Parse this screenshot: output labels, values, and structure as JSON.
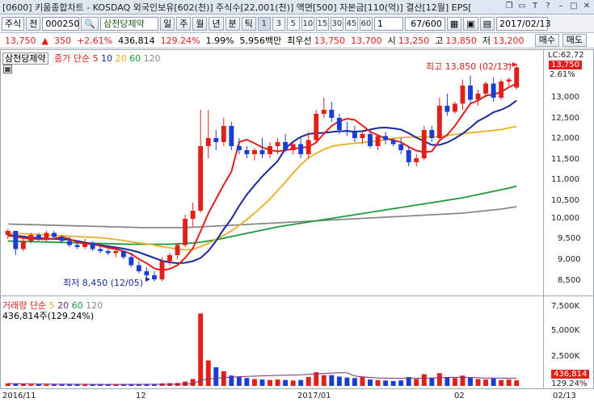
{
  "titlebar": {
    "text": "[0600] 키움종합차트 - KOSDAQ 외국인보유[602(천)] 주식수[22,001(천)] 액면[500] 자본금[110(억)] 결산[12월] EPS["
  },
  "toolbar": {
    "market": "주식",
    "prev": "전",
    "code": "000250",
    "name": "삼천당제약",
    "periods": [
      "일",
      "주",
      "월",
      "년",
      "분",
      "틱"
    ],
    "numbers": [
      "1",
      "3",
      "5",
      "10",
      "15",
      "30",
      "45",
      "60"
    ],
    "count": "67/600",
    "date": "2017/02/13"
  },
  "pricebar": {
    "price": "13,750",
    "arrow": "▲",
    "change": "350",
    "change_pct": "+2.61%",
    "volume": "436,814",
    "vol_ratio": "129.24%",
    "turnover": "1.99%",
    "amount": "5,956백만",
    "pref_label": "최우선",
    "pref": "13,750",
    "ask": "13,700",
    "open_label": "시",
    "open": "13,250",
    "high_label": "고",
    "high": "13,850",
    "low_label": "저",
    "low": "13,200",
    "buy": "매수",
    "sell": "매도"
  },
  "price_panel": {
    "title": "삼천당제약",
    "legend_main": "종가 단순",
    "ma": [
      "5",
      "10",
      "20",
      "60",
      "120"
    ],
    "ma_colors": [
      "#e0201b",
      "#1a2a9a",
      "#e8b020",
      "#1f9a3a",
      "#888888"
    ],
    "lc": "LC:62.72",
    "last_price": "13,750",
    "last_pct": "2.61%",
    "max_note": "최고 13,850 (02/13)",
    "min_note": "최저 8,450 (12/05)",
    "y_ticks": [
      "13,000",
      "12,500",
      "12,000",
      "11,500",
      "11,000",
      "10,500",
      "10,000",
      "9,500",
      "9,000",
      "8,500"
    ]
  },
  "volume_panel": {
    "legend_main": "거래량 단순",
    "ma": [
      "5",
      "20",
      "60",
      "120"
    ],
    "current": "436,814주(129.24%)",
    "last_value": "436,814",
    "last_pct": "129.24%",
    "y_ticks": [
      "7,500K",
      "5,000K",
      "2,500K"
    ]
  },
  "x_labels": [
    "2016/11",
    "12",
    "2017/01",
    "02",
    "02/13"
  ],
  "chart_data": {
    "type": "candlestick",
    "ylim": [
      8200,
      14100
    ],
    "candles": [
      [
        9600,
        9750,
        9500,
        9700
      ],
      [
        9700,
        9700,
        9100,
        9250
      ],
      [
        9250,
        9500,
        9200,
        9450
      ],
      [
        9450,
        9650,
        9400,
        9600
      ],
      [
        9600,
        9650,
        9450,
        9500
      ],
      [
        9500,
        9700,
        9450,
        9650
      ],
      [
        9650,
        9700,
        9500,
        9550
      ],
      [
        9550,
        9600,
        9400,
        9450
      ],
      [
        9450,
        9550,
        9300,
        9350
      ],
      [
        9350,
        9450,
        9250,
        9300
      ],
      [
        9300,
        9500,
        9250,
        9400
      ],
      [
        9400,
        9450,
        9200,
        9250
      ],
      [
        9250,
        9350,
        9150,
        9200
      ],
      [
        9200,
        9250,
        9100,
        9150
      ],
      [
        9150,
        9250,
        9050,
        9200
      ],
      [
        9200,
        9200,
        9000,
        9050
      ],
      [
        9050,
        9150,
        8800,
        8850
      ],
      [
        8850,
        8950,
        8650,
        8700
      ],
      [
        8700,
        8800,
        8550,
        8600
      ],
      [
        8600,
        8700,
        8450,
        8500
      ],
      [
        8500,
        9050,
        8450,
        8950
      ],
      [
        8950,
        9150,
        8850,
        9100
      ],
      [
        9100,
        9400,
        9000,
        9350
      ],
      [
        9350,
        10100,
        9300,
        10000
      ],
      [
        10000,
        10400,
        9800,
        10200
      ],
      [
        10200,
        12700,
        10150,
        11800
      ],
      [
        11800,
        12700,
        11500,
        12000
      ],
      [
        12000,
        12200,
        11700,
        11900
      ],
      [
        11900,
        12500,
        11800,
        12300
      ],
      [
        12300,
        12400,
        11700,
        11800
      ],
      [
        11800,
        12000,
        11600,
        11700
      ],
      [
        11700,
        11800,
        11500,
        11600
      ],
      [
        11600,
        11750,
        11450,
        11700
      ],
      [
        11700,
        12000,
        11500,
        11600
      ],
      [
        11600,
        11900,
        11500,
        11800
      ],
      [
        11800,
        12000,
        11600,
        11900
      ],
      [
        11900,
        12100,
        11650,
        11700
      ],
      [
        11700,
        11900,
        11600,
        11850
      ],
      [
        11850,
        12000,
        11500,
        11600
      ],
      [
        11600,
        12150,
        11500,
        11950
      ],
      [
        11950,
        12700,
        11900,
        12600
      ],
      [
        12600,
        13000,
        12500,
        12700
      ],
      [
        12700,
        12900,
        12400,
        12500
      ],
      [
        12500,
        12600,
        12100,
        12200
      ],
      [
        12200,
        12400,
        12050,
        12150
      ],
      [
        12150,
        12300,
        11900,
        12000
      ],
      [
        12000,
        12200,
        11850,
        12100
      ],
      [
        12100,
        12150,
        11750,
        11800
      ],
      [
        11800,
        12100,
        11700,
        12050
      ],
      [
        12050,
        12150,
        11850,
        11950
      ],
      [
        11950,
        12000,
        11800,
        11850
      ],
      [
        11850,
        12000,
        11600,
        11700
      ],
      [
        11700,
        11800,
        11300,
        11400
      ],
      [
        11400,
        11600,
        11300,
        11500
      ],
      [
        11500,
        12300,
        11450,
        12200
      ],
      [
        12200,
        12300,
        11900,
        12000
      ],
      [
        12000,
        13000,
        11950,
        12800
      ],
      [
        12800,
        13100,
        12550,
        12650
      ],
      [
        12650,
        12900,
        12600,
        12850
      ],
      [
        12850,
        13450,
        12700,
        13300
      ],
      [
        13300,
        13550,
        12850,
        12950
      ],
      [
        12950,
        13200,
        12800,
        13100
      ],
      [
        13100,
        13400,
        13000,
        13350
      ],
      [
        13350,
        13500,
        12900,
        13000
      ],
      [
        13000,
        13450,
        12950,
        13400
      ],
      [
        13400,
        13500,
        13300,
        13450
      ],
      [
        13250,
        13850,
        13200,
        13750
      ]
    ],
    "volumes_k": [
      250,
      200,
      180,
      150,
      170,
      140,
      130,
      160,
      150,
      140,
      130,
      120,
      150,
      140,
      130,
      160,
      190,
      200,
      170,
      160,
      260,
      280,
      300,
      450,
      700,
      7400,
      2600,
      1900,
      1500,
      1050,
      900,
      800,
      700,
      650,
      600,
      650,
      600,
      550,
      600,
      900,
      1400,
      1100,
      1100,
      950,
      850,
      800,
      900,
      650,
      600,
      550,
      500,
      560,
      900,
      700,
      1200,
      800,
      1300,
      900,
      800,
      1050,
      850,
      700,
      650,
      750,
      600,
      650,
      560
    ],
    "ma_values": {
      "5": [
        9580,
        9560,
        9520,
        9500,
        9500,
        9490,
        9510,
        9550,
        9500,
        9420,
        9380,
        9370,
        9330,
        9280,
        9250,
        9200,
        9130,
        9000,
        8900,
        8770,
        8720,
        8760,
        8850,
        9030,
        9270,
        9690,
        10130,
        10490,
        10840,
        11170,
        11900,
        11960,
        11870,
        11770,
        11700,
        11670,
        11700,
        11730,
        11760,
        11780,
        11890,
        12110,
        12300,
        12420,
        12480,
        12450,
        12310,
        12160,
        12070,
        11990,
        11950,
        11900,
        11780,
        11690,
        11650,
        11670,
        11940,
        12080,
        12300,
        12580,
        12850,
        12930,
        13050,
        13080,
        13140,
        13260,
        13350
      ],
      "10": [
        9600,
        9580,
        9560,
        9540,
        9520,
        9510,
        9500,
        9500,
        9480,
        9450,
        9410,
        9380,
        9350,
        9320,
        9290,
        9260,
        9220,
        9170,
        9100,
        9030,
        8960,
        8920,
        8900,
        8910,
        8950,
        9030,
        9200,
        9450,
        9740,
        10000,
        10320,
        10600,
        10830,
        11050,
        11240,
        11430,
        11740,
        11910,
        12030,
        12100,
        12120,
        12130,
        12150,
        12170,
        12170,
        12160,
        12170,
        12210,
        12250,
        12260,
        12240,
        12210,
        12120,
        12010,
        11920,
        11830,
        11830,
        11890,
        11990,
        12110,
        12260,
        12420,
        12520,
        12640,
        12700,
        12790,
        12930
      ],
      "20": [
        9650,
        9640,
        9630,
        9620,
        9610,
        9600,
        9590,
        9580,
        9570,
        9560,
        9550,
        9540,
        9530,
        9510,
        9490,
        9460,
        9430,
        9400,
        9380,
        9350,
        9310,
        9280,
        9250,
        9230,
        9240,
        9310,
        9390,
        9490,
        9590,
        9700,
        9830,
        9980,
        10140,
        10310,
        10490,
        10700,
        10910,
        11130,
        11340,
        11510,
        11620,
        11720,
        11790,
        11830,
        11850,
        11870,
        11890,
        11910,
        11930,
        11960,
        11990,
        12010,
        12020,
        12030,
        12030,
        12030,
        12040,
        12060,
        12090,
        12110,
        12130,
        12150,
        12170,
        12190,
        12210,
        12250,
        12290
      ],
      "60": [
        9450,
        9445,
        9440,
        9435,
        9430,
        9425,
        9420,
        9415,
        9410,
        9405,
        9400,
        9395,
        9390,
        9385,
        9380,
        9375,
        9370,
        9370,
        9370,
        9370,
        9370,
        9370,
        9380,
        9390,
        9400,
        9420,
        9450,
        9480,
        9520,
        9560,
        9600,
        9640,
        9680,
        9720,
        9760,
        9800,
        9830,
        9860,
        9890,
        9920,
        9950,
        9980,
        10010,
        10040,
        10070,
        10100,
        10130,
        10160,
        10190,
        10220,
        10250,
        10280,
        10310,
        10340,
        10370,
        10400,
        10430,
        10460,
        10490,
        10520,
        10560,
        10600,
        10640,
        10680,
        10720,
        10760,
        10810
      ],
      "120": [
        9870,
        9865,
        9860,
        9855,
        9850,
        9845,
        9840,
        9835,
        9830,
        9825,
        9820,
        9815,
        9810,
        9805,
        9800,
        9795,
        9790,
        9785,
        9780,
        9780,
        9780,
        9780,
        9780,
        9785,
        9790,
        9800,
        9810,
        9820,
        9830,
        9840,
        9850,
        9860,
        9870,
        9880,
        9890,
        9900,
        9910,
        9920,
        9930,
        9940,
        9950,
        9960,
        9970,
        9980,
        9990,
        10000,
        10010,
        10020,
        10030,
        10040,
        10050,
        10060,
        10070,
        10080,
        10090,
        10100,
        10110,
        10120,
        10130,
        10140,
        10160,
        10180,
        10200,
        10220,
        10240,
        10270,
        10300
      ]
    }
  }
}
